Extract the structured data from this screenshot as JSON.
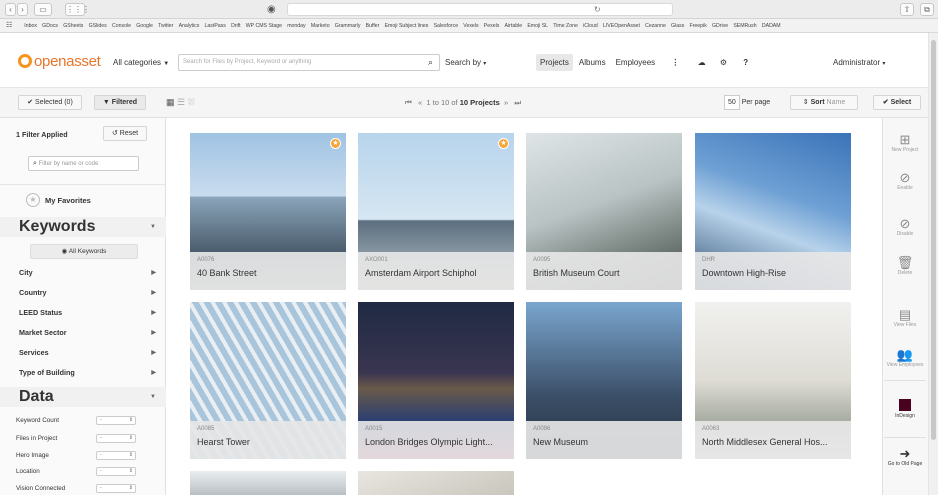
{
  "bookmarks": [
    "Inbox",
    "GDocs",
    "GSheets",
    "GSlides",
    "Console",
    "Google",
    "Twitter",
    "Analytics",
    "LastPass",
    "Drift",
    "WP CMS Stage",
    "monday",
    "Marketo",
    "Grammarly",
    "Buffer",
    "Emoji Subject lines",
    "Salesforce",
    "Vexels",
    "Pexels",
    "Airtable",
    "Emoji SL",
    "Time Zone",
    "iCloud",
    "LIVEOpenAsset",
    "Cezanne",
    "Glass",
    "Freepik",
    "GDrive",
    "SEMRush",
    "DADAM"
  ],
  "header": {
    "logo": "openasset",
    "category": "All categories",
    "search_placeholder": "Search for Files by Project, Keyword or anything",
    "search_by": "Search by",
    "tabs": [
      "Projects",
      "Albums",
      "Employees"
    ],
    "user": "Administrator"
  },
  "toolbar": {
    "selected": "Selected (0)",
    "filtered": "Filtered",
    "pager_text": "1 to 10 of",
    "pager_bold": "10 Projects",
    "per_page_value": "50",
    "per_page_label": "Per page",
    "sort_label": "Sort",
    "sort_value": "Name",
    "select": "Select"
  },
  "sidebar": {
    "filters_applied": "1 Filter Applied",
    "reset": "Reset",
    "filter_placeholder": "Filter by name or code",
    "favorites": "My Favorites",
    "keywords_head": "Keywords",
    "all_keywords": "All Keywords",
    "keyword_items": [
      "City",
      "Country",
      "LEED Status",
      "Market Sector",
      "Services",
      "Type of Building"
    ],
    "data_head": "Data",
    "data_items": [
      "Keyword Count",
      "Files in Project",
      "Hero Image",
      "Location",
      "Vision Connected"
    ],
    "data_dropdown_value": "-"
  },
  "projects": [
    {
      "code": "A0076",
      "title": "40 Bank Street"
    },
    {
      "code": "AXO001",
      "title": "Amsterdam Airport Schiphol"
    },
    {
      "code": "A0095",
      "title": "British Museum Court"
    },
    {
      "code": "DHR",
      "title": "Downtown High-Rise"
    },
    {
      "code": "A0085",
      "title": "Hearst Tower"
    },
    {
      "code": "A0015",
      "title": "London Bridges Olympic Light..."
    },
    {
      "code": "A0096",
      "title": "New Museum"
    },
    {
      "code": "A0063",
      "title": "North Middlesex General Hos..."
    }
  ],
  "rail": [
    "New Project",
    "Enable",
    "Disable",
    "Delete",
    "View Files",
    "View Employees",
    "InDesign",
    "Go to Old Page"
  ],
  "colors": {
    "brand": "#f7941d",
    "star": "#f7a536",
    "indesign": "#49021f"
  }
}
